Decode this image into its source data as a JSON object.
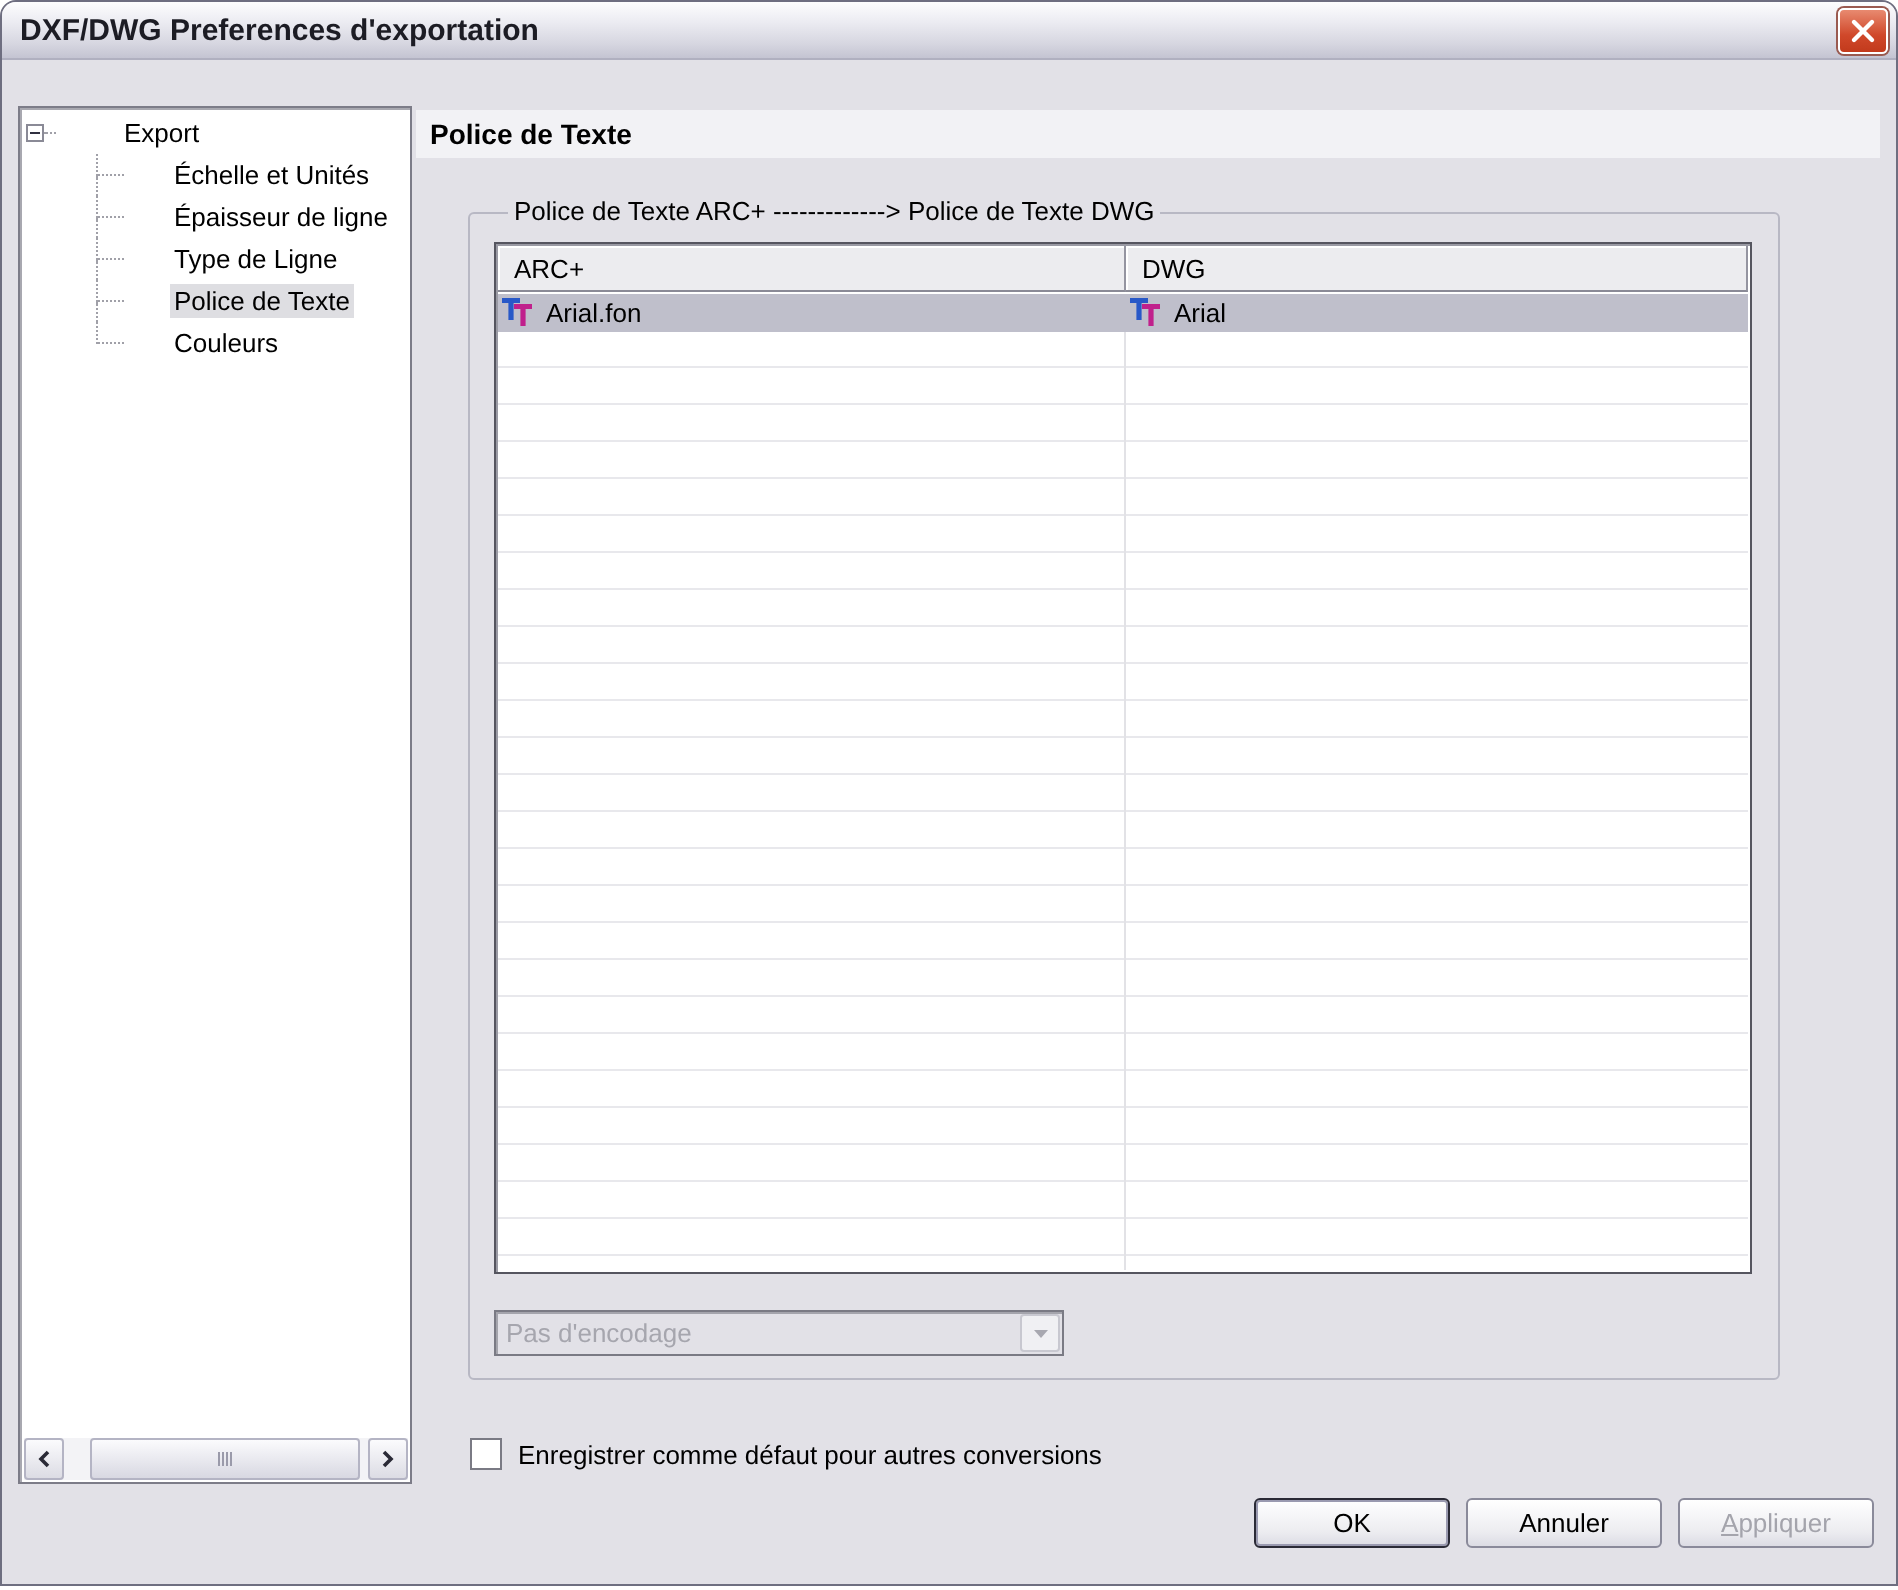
{
  "window": {
    "title": "DXF/DWG Preferences d'exportation"
  },
  "tree": {
    "items": [
      {
        "label": "Export",
        "selected": false,
        "expanded": true,
        "children": [
          {
            "label": "Échelle et Unités",
            "selected": false
          },
          {
            "label": "Épaisseur de ligne",
            "selected": false
          },
          {
            "label": "Type de Ligne",
            "selected": false
          },
          {
            "label": "Police de Texte",
            "selected": true
          },
          {
            "label": "Couleurs",
            "selected": false
          }
        ]
      }
    ]
  },
  "panel": {
    "title": "Police de Texte",
    "group_title": "Police de Texte ARC+ -------------> Police de Texte DWG",
    "table": {
      "columns": [
        "ARC+",
        "DWG"
      ],
      "rows": [
        {
          "selected": true,
          "cells": [
            "Arial.fon",
            "Arial"
          ]
        }
      ]
    },
    "encoding": {
      "value": "Pas d'encodage",
      "disabled": true
    }
  },
  "save_default": {
    "label": "Enregistrer comme défaut pour autres conversions",
    "checked": false
  },
  "buttons": [
    {
      "label": "OK",
      "default": true,
      "disabled": false,
      "access_key": false
    },
    {
      "label": "Annuler",
      "default": false,
      "disabled": false,
      "access_key": false
    },
    {
      "label": "Appliquer",
      "default": false,
      "disabled": true,
      "access_key": true
    }
  ]
}
